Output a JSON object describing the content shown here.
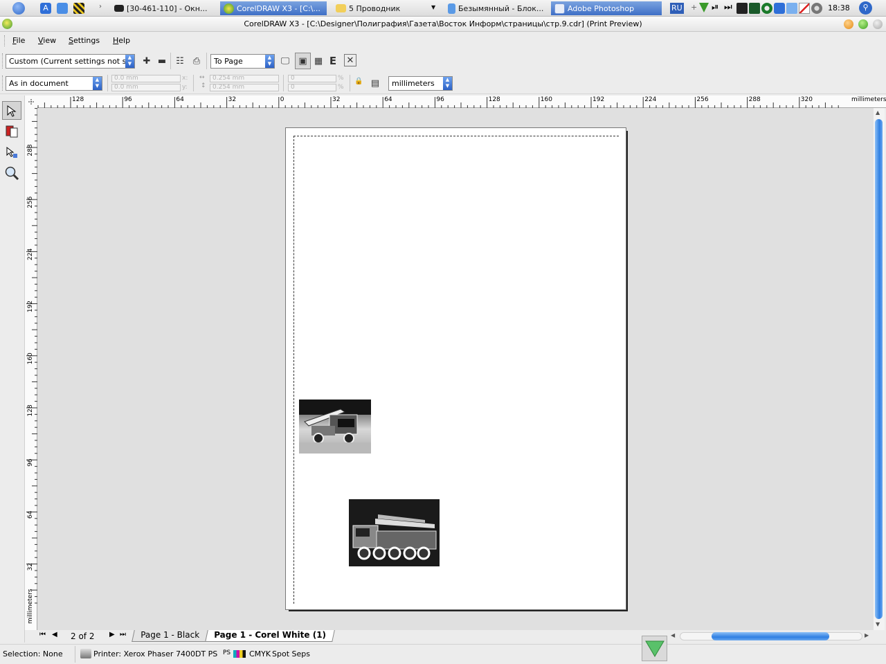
{
  "taskbar": {
    "items": [
      {
        "label": "[30-461-110] - Окн...",
        "icon_name": "chat-icon",
        "active": false
      },
      {
        "label": "CorelDRAW X3 - [C:\\...",
        "icon_name": "coreldraw-icon",
        "active": true
      },
      {
        "label": "5 Проводник",
        "icon_name": "folder-icon",
        "active": false
      },
      {
        "label": "Безымянный - Блок...",
        "icon_name": "notepad-icon",
        "active": false
      },
      {
        "label": "Adobe Photoshop",
        "icon_name": "photoshop-icon",
        "active": true
      }
    ],
    "lang": "RU",
    "clock": "18:38"
  },
  "window": {
    "title": "CorelDRAW X3 - [C:\\Designer\\Полиграфия\\Газета\\Восток Информ\\страницы\\стр.9.cdr] (Print Preview)"
  },
  "menu": {
    "items": [
      {
        "label": "File",
        "key": "F",
        "rest": "ile"
      },
      {
        "label": "View",
        "key": "V",
        "rest": "iew"
      },
      {
        "label": "Settings",
        "key": "S",
        "rest": "ettings"
      },
      {
        "label": "Help",
        "key": "H",
        "rest": "elp"
      }
    ]
  },
  "toolbar": {
    "style_combo": "Custom (Current settings not s...",
    "fit_combo": "To Page",
    "position_combo": "As in document",
    "x_value": "0.0 mm",
    "y_value": "0.0 mm",
    "w_value": "0.254 mm",
    "h_value": "0.254 mm",
    "scale_w": "0",
    "scale_h": "0",
    "pct1": "%",
    "pct2": "%",
    "xlab": "x:",
    "ylab": "y:",
    "units_combo": "millimeters"
  },
  "ruler": {
    "units": "millimeters",
    "h_ticks": [
      "128",
      "96",
      "64",
      "32",
      "0",
      "32",
      "64",
      "96",
      "128",
      "160",
      "192",
      "224",
      "256",
      "288",
      "320"
    ],
    "v_ticks": [
      "288",
      "256",
      "224",
      "192",
      "160",
      "128",
      "96",
      "64",
      "32"
    ]
  },
  "pagenav": {
    "page_count": "2 of 2",
    "tabs": [
      "Page 1 - Black",
      "Page 1 - Corel White (1)"
    ]
  },
  "statusbar": {
    "selection": "Selection: None",
    "printer": "Printer: Xerox Phaser 7400DT PS",
    "ps": "PS",
    "color": "CMYK",
    "seps": "Spot Seps"
  },
  "colors": {
    "accent": "#3e6fc6",
    "scroll": "#3b8de8"
  }
}
